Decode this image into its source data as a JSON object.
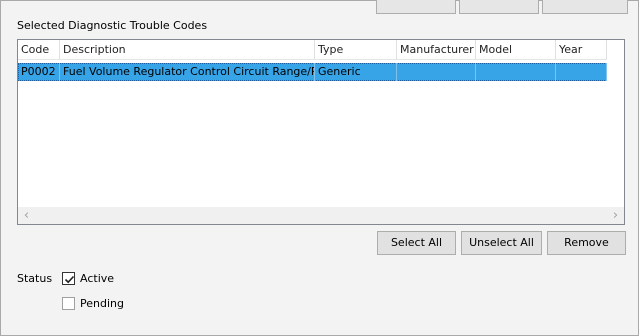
{
  "group": {
    "title": "Selected Diagnostic Trouble Codes"
  },
  "table": {
    "columns": [
      "Code",
      "Description",
      "Type",
      "Manufacturer",
      "Model",
      "Year"
    ],
    "rows": [
      {
        "code": "P0002",
        "description": "Fuel Volume Regulator Control Circuit Range/P...",
        "type": "Generic",
        "manufacturer": "",
        "model": "",
        "year": ""
      }
    ]
  },
  "buttons": {
    "select_all": "Select All",
    "unselect_all": "Unselect All",
    "remove": "Remove"
  },
  "status": {
    "label": "Status",
    "active": {
      "label": "Active",
      "checked": true
    },
    "pending": {
      "label": "Pending",
      "checked": false
    }
  }
}
